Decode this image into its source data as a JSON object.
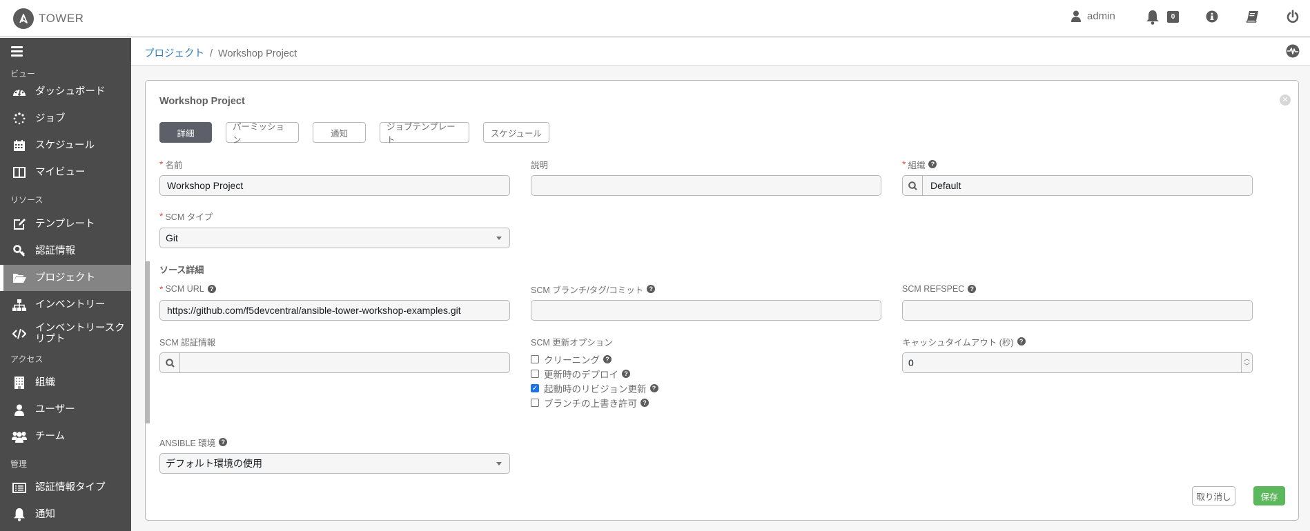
{
  "header": {
    "logo_letter": "A",
    "app_name": "TOWER",
    "user": "admin",
    "notification_count": "0",
    "icons": [
      "user-icon",
      "bell-icon",
      "info-icon",
      "book-icon",
      "power-icon"
    ]
  },
  "sidebar": {
    "sections": [
      {
        "label": "ビュー"
      },
      {
        "label": "リソース"
      },
      {
        "label": "アクセス"
      },
      {
        "label": "管理"
      }
    ],
    "items": [
      {
        "label": "ダッシュボード",
        "icon": "dashboard-icon"
      },
      {
        "label": "ジョブ",
        "icon": "jobs-spinner-icon"
      },
      {
        "label": "スケジュール",
        "icon": "calendar-icon"
      },
      {
        "label": "マイビュー",
        "icon": "columns-icon"
      },
      {
        "label": "テンプレート",
        "icon": "edit-icon"
      },
      {
        "label": "認証情報",
        "icon": "key-icon"
      },
      {
        "label": "プロジェクト",
        "icon": "folder-open-icon",
        "active": true
      },
      {
        "label": "インベントリー",
        "icon": "sitemap-icon"
      },
      {
        "label": "インベントリースクリプト",
        "label_line1": "インベントリースク",
        "label_line2": "リプト",
        "icon": "code-icon"
      },
      {
        "label": "組織",
        "icon": "building-icon"
      },
      {
        "label": "ユーザー",
        "icon": "user-icon"
      },
      {
        "label": "チーム",
        "icon": "users-icon"
      },
      {
        "label": "認証情報タイプ",
        "icon": "list-alt-icon"
      },
      {
        "label": "通知",
        "icon": "bell-icon"
      }
    ]
  },
  "breadcrumb": {
    "parent": "プロジェクト",
    "separator": "/",
    "current": "Workshop Project"
  },
  "panel": {
    "title": "Workshop Project",
    "tabs": [
      {
        "label": "詳細",
        "active": true
      },
      {
        "label": "パーミッション"
      },
      {
        "label": "通知"
      },
      {
        "label": "ジョブテンプレート"
      },
      {
        "label": "スケジュール"
      }
    ],
    "fields": {
      "name": {
        "label": "名前",
        "required": true,
        "value": "Workshop Project"
      },
      "description": {
        "label": "説明",
        "value": ""
      },
      "organization": {
        "label": "組織",
        "required": true,
        "value": "Default"
      },
      "scm_type": {
        "label": "SCM タイプ",
        "required": true,
        "value": "Git"
      },
      "source_details_title": "ソース詳細",
      "scm_url": {
        "label": "SCM URL",
        "required": true,
        "value": "https://github.com/f5devcentral/ansible-tower-workshop-examples.git"
      },
      "scm_branch": {
        "label": "SCM ブランチ/タグ/コミット",
        "value": ""
      },
      "scm_refspec": {
        "label": "SCM REFSPEC",
        "value": ""
      },
      "scm_credential": {
        "label": "SCM 認証情報",
        "value": ""
      },
      "scm_update_options": {
        "label": "SCM 更新オプション",
        "options": [
          {
            "label": "クリーニング",
            "checked": false
          },
          {
            "label": "更新時のデプロイ",
            "checked": false
          },
          {
            "label": "起動時のリビジョン更新",
            "checked": true
          },
          {
            "label": "ブランチの上書き許可",
            "checked": false
          }
        ]
      },
      "cache_timeout": {
        "label": "キャッシュタイムアウト (秒)",
        "value": "0"
      },
      "ansible_env": {
        "label": "ANSIBLE 環境",
        "value": "デフォルト環境の使用"
      }
    },
    "buttons": {
      "cancel": "取り消し",
      "save": "保存"
    }
  },
  "colors": {
    "sidebar_bg": "#4b4b4b",
    "sidebar_active": "#848484",
    "link": "#337ab7",
    "required": "#d9534f",
    "save": "#5cb85c",
    "active_tab": "#5d6068",
    "checkbox_checked": "#1a73e8"
  }
}
